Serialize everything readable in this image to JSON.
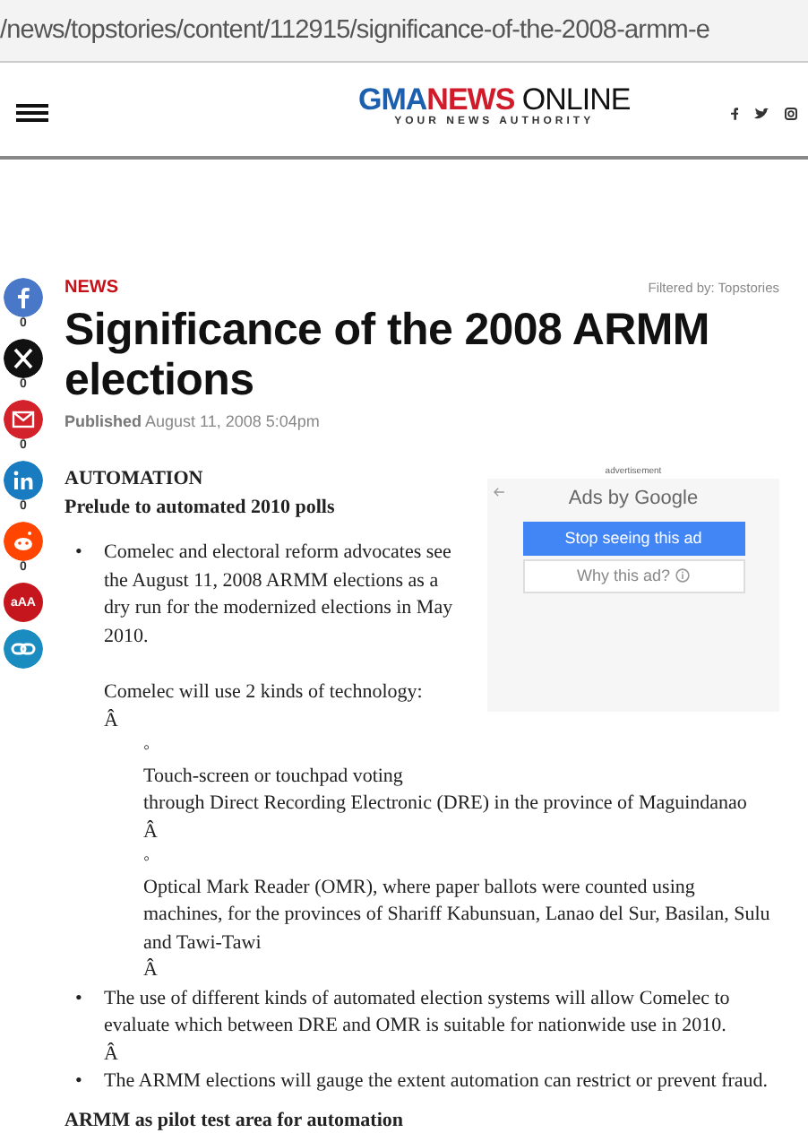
{
  "address_bar": {
    "url": "/news/topstories/content/112915/significance-of-the-2008-armm-e"
  },
  "header": {
    "logo": {
      "part_1": "GMA",
      "part_2": "NEWS",
      "part_3": "ONLINE",
      "tagline": "YOUR NEWS AUTHORITY"
    },
    "social": [
      {
        "kind": "facebook"
      },
      {
        "kind": "twitter"
      },
      {
        "kind": "instagram"
      }
    ]
  },
  "share_bar": [
    {
      "kind": "facebook",
      "color": "#4a78c8",
      "count": "0"
    },
    {
      "kind": "x",
      "color": "#111111",
      "count": "0"
    },
    {
      "kind": "email",
      "color": "#d4222a",
      "count": "0"
    },
    {
      "kind": "linkedin",
      "color": "#1a7cc0",
      "count": "0"
    },
    {
      "kind": "reddit",
      "color": "#ff4500",
      "count": "0"
    },
    {
      "kind": "font-size",
      "color": "#c4161c",
      "label": "aAA"
    },
    {
      "kind": "link",
      "color": "#1a8cbf"
    }
  ],
  "article": {
    "section": "NEWS",
    "filter": "Filtered by: Topstories",
    "title": "Significance of the 2008 ARMM elections",
    "published": "**Published** August 11, 2008 5:04pm",
    "heading": "AUTOMATION",
    "subheading": "Prelude to automated 2010 polls",
    "ad": {
      "label": "advertisement",
      "by": "Ads by Google",
      "stop": "Stop seeing this ad",
      "why": "Why this ad?"
    },
    "bullets": [
      {
        "marker": "•",
        "text": "Comelec and electoral reform advocates see the August 11, 2008 ARMM elections as a dry run for the modernized elections in May 2010.",
        "extra": [
          "Comelec will use 2 kinds of technology:",
          "Â"
        ],
        "children": [
          {
            "marker": "◦",
            "lines": [
              "Touch-screen or touchpad voting",
              "through Direct Recording Electronic (DRE) in the province of Maguindanao",
              "Â"
            ]
          },
          {
            "marker": "◦",
            "lines": [
              "Optical Mark Reader (OMR), where paper ballots were counted using machines, for the provinces of Shariff Kabunsuan, Lanao del Sur, Basilan, Sulu and Tawi-Tawi",
              "Â"
            ]
          }
        ]
      },
      {
        "marker": "•",
        "text": "The use of different kinds of automated election systems will allow Comelec to evaluate which between DRE and OMR is suitable for nationwide use in 2010.",
        "extra": [
          "Â"
        ]
      },
      {
        "marker": "•",
        "text": "The ARMM elections will gauge the extent automation can restrict or prevent fraud."
      }
    ],
    "heading_2": "ARMM as pilot test area for automation"
  }
}
